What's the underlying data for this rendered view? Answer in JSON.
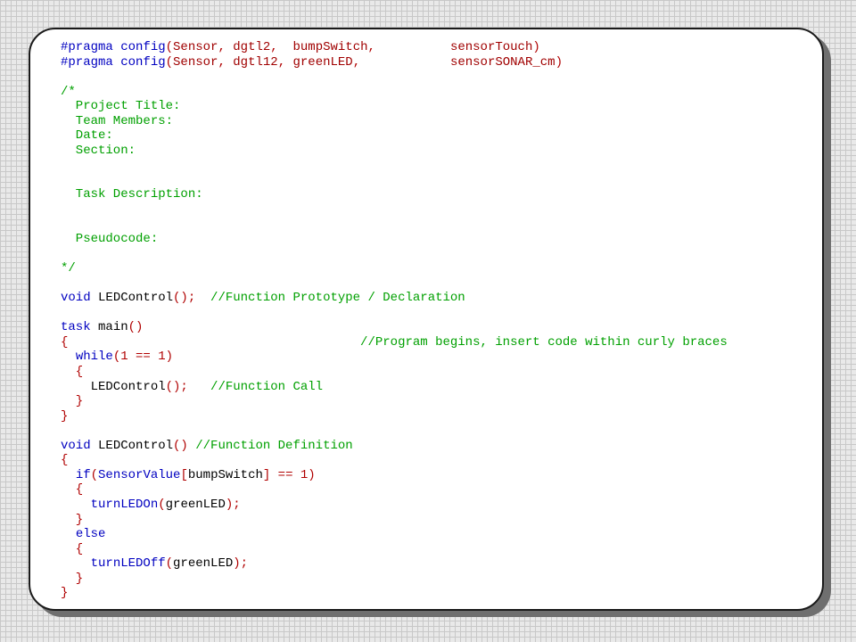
{
  "lines": [
    [
      {
        "t": "#pragma config",
        "c": "kw"
      },
      {
        "t": "(",
        "c": "pu"
      },
      {
        "t": "Sensor",
        "c": "pp"
      },
      {
        "t": ", ",
        "c": "pu"
      },
      {
        "t": "dgtl2",
        "c": "pp"
      },
      {
        "t": ",  ",
        "c": "pu"
      },
      {
        "t": "bumpSwitch",
        "c": "pp"
      },
      {
        "t": ",          ",
        "c": "pu"
      },
      {
        "t": "sensorTouch",
        "c": "pp"
      },
      {
        "t": ")",
        "c": "pu"
      }
    ],
    [
      {
        "t": "#pragma config",
        "c": "kw"
      },
      {
        "t": "(",
        "c": "pu"
      },
      {
        "t": "Sensor",
        "c": "pp"
      },
      {
        "t": ", ",
        "c": "pu"
      },
      {
        "t": "dgtl12",
        "c": "pp"
      },
      {
        "t": ", ",
        "c": "pu"
      },
      {
        "t": "greenLED",
        "c": "pp"
      },
      {
        "t": ",            ",
        "c": "pu"
      },
      {
        "t": "sensorSONAR_cm",
        "c": "pp"
      },
      {
        "t": ")",
        "c": "pu"
      }
    ],
    [],
    [
      {
        "t": "/*",
        "c": "cm"
      }
    ],
    [
      {
        "t": "  Project Title:",
        "c": "cm"
      }
    ],
    [
      {
        "t": "  Team Members:",
        "c": "cm"
      }
    ],
    [
      {
        "t": "  Date:",
        "c": "cm"
      }
    ],
    [
      {
        "t": "  Section:",
        "c": "cm"
      }
    ],
    [],
    [],
    [
      {
        "t": "  Task Description:",
        "c": "cm"
      }
    ],
    [],
    [],
    [
      {
        "t": "  Pseudocode:",
        "c": "cm"
      }
    ],
    [],
    [
      {
        "t": "*/",
        "c": "cm"
      }
    ],
    [],
    [
      {
        "t": "void",
        "c": "kw"
      },
      {
        "t": " LEDControl",
        "c": "tk"
      },
      {
        "t": "();",
        "c": "pu"
      },
      {
        "t": "  //Function Prototype / Declaration",
        "c": "cm"
      }
    ],
    [],
    [
      {
        "t": "task",
        "c": "kw"
      },
      {
        "t": " main",
        "c": "tk"
      },
      {
        "t": "()",
        "c": "pu"
      }
    ],
    [
      {
        "t": "{",
        "c": "pu"
      },
      {
        "t": "                                       //Program begins, insert code within curly braces",
        "c": "cm"
      }
    ],
    [
      {
        "t": "  ",
        "c": "tk"
      },
      {
        "t": "while",
        "c": "kw"
      },
      {
        "t": "(1 == 1)",
        "c": "pu"
      }
    ],
    [
      {
        "t": "  {",
        "c": "pu"
      }
    ],
    [
      {
        "t": "    LEDControl",
        "c": "tk"
      },
      {
        "t": "();",
        "c": "pu"
      },
      {
        "t": "   //Function Call",
        "c": "cm"
      }
    ],
    [
      {
        "t": "  }",
        "c": "pu"
      }
    ],
    [
      {
        "t": "}",
        "c": "pu"
      }
    ],
    [],
    [
      {
        "t": "void",
        "c": "kw"
      },
      {
        "t": " LEDControl",
        "c": "tk"
      },
      {
        "t": "()",
        "c": "pu"
      },
      {
        "t": " //Function Definition",
        "c": "cm"
      }
    ],
    [
      {
        "t": "{",
        "c": "pu"
      }
    ],
    [
      {
        "t": "  ",
        "c": "tk"
      },
      {
        "t": "if",
        "c": "kw"
      },
      {
        "t": "(",
        "c": "pu"
      },
      {
        "t": "SensorValue",
        "c": "kw"
      },
      {
        "t": "[",
        "c": "pu"
      },
      {
        "t": "bumpSwitch",
        "c": "tk"
      },
      {
        "t": "] == 1)",
        "c": "pu"
      }
    ],
    [
      {
        "t": "  {",
        "c": "pu"
      }
    ],
    [
      {
        "t": "    ",
        "c": "tk"
      },
      {
        "t": "turnLEDOn",
        "c": "kw"
      },
      {
        "t": "(",
        "c": "pu"
      },
      {
        "t": "greenLED",
        "c": "tk"
      },
      {
        "t": ");",
        "c": "pu"
      }
    ],
    [
      {
        "t": "  }",
        "c": "pu"
      }
    ],
    [
      {
        "t": "  ",
        "c": "tk"
      },
      {
        "t": "else",
        "c": "kw"
      }
    ],
    [
      {
        "t": "  {",
        "c": "pu"
      }
    ],
    [
      {
        "t": "    ",
        "c": "tk"
      },
      {
        "t": "turnLEDOff",
        "c": "kw"
      },
      {
        "t": "(",
        "c": "pu"
      },
      {
        "t": "greenLED",
        "c": "tk"
      },
      {
        "t": ");",
        "c": "pu"
      }
    ],
    [
      {
        "t": "  }",
        "c": "pu"
      }
    ],
    [
      {
        "t": "}",
        "c": "pu"
      }
    ]
  ]
}
